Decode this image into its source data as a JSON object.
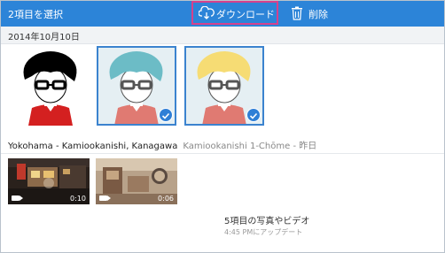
{
  "toolbar": {
    "selection_label": "2項目を選択",
    "download_label": "ダウンロード",
    "delete_label": "削除"
  },
  "date_header": "2014年10月10日",
  "photos": [
    {
      "kind": "avatar",
      "hair": "#000000",
      "bg": "#ffffff",
      "shirt": "#d42020",
      "selected": false
    },
    {
      "kind": "avatar",
      "hair": "#6cbcc6",
      "bg": "#e5eff3",
      "shirt": "#e07a72",
      "selected": true
    },
    {
      "kind": "avatar",
      "hair": "#f6dc74",
      "bg": "#e5eff3",
      "shirt": "#e07a72",
      "selected": true
    }
  ],
  "location": {
    "place": "Yokohama - Kamiookanishi, Kanagawa",
    "detail": "Kamiookanishi 1-Chōme - 昨日"
  },
  "videos": [
    {
      "duration": "0:10"
    },
    {
      "duration": "0:06"
    }
  ],
  "summary": {
    "count_text": "5項目の写真やビデオ",
    "updated_text": "4:45 PMにアップデート"
  },
  "colors": {
    "toolbar_bg": "#2c84d8",
    "highlight_border": "#d6418c",
    "selection_blue": "#3b83cf"
  }
}
